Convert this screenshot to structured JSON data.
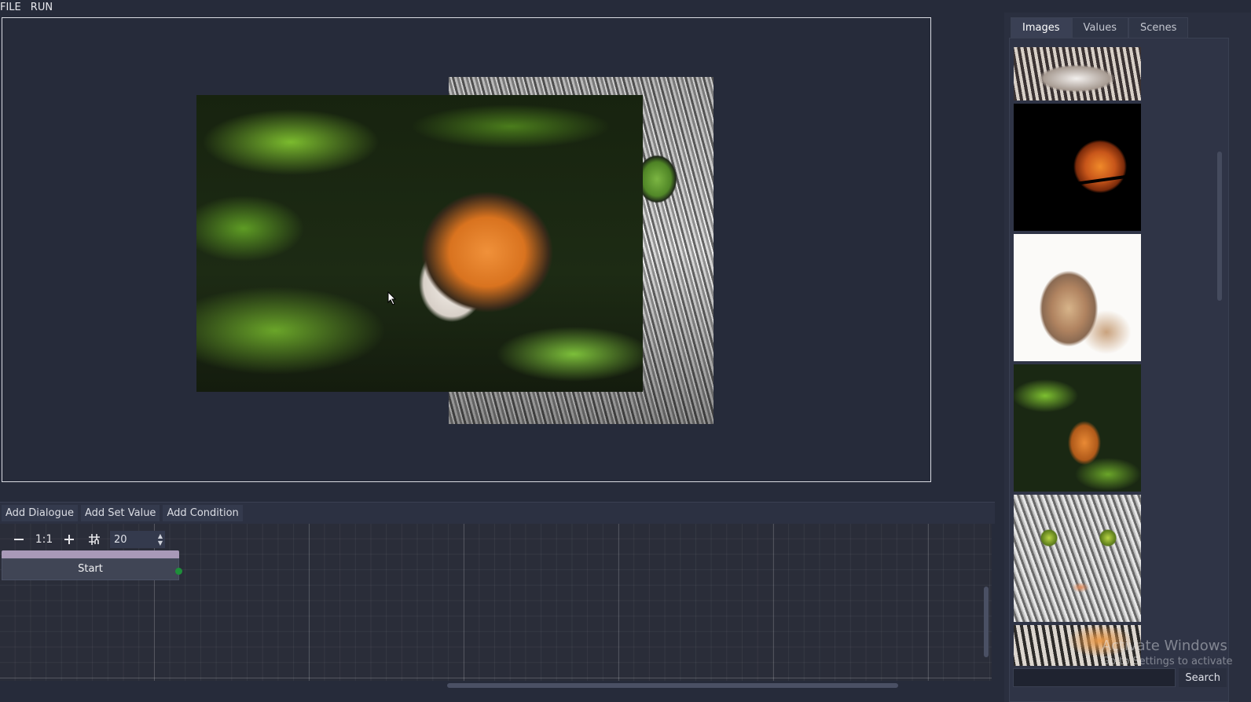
{
  "menu": {
    "file": "FILE",
    "run": "RUN"
  },
  "canvas": {
    "images": [
      {
        "name": "cat-closeup"
      },
      {
        "name": "tiger-in-water"
      }
    ]
  },
  "side_panel": {
    "tabs": [
      {
        "label": "Images",
        "active": true
      },
      {
        "label": "Values",
        "active": false
      },
      {
        "label": "Scenes",
        "active": false
      }
    ],
    "search": {
      "value": "",
      "button_label": "Search"
    }
  },
  "graph_toolbar": {
    "add_dialogue": "Add Dialogue",
    "add_set_value": "Add Set Value",
    "add_condition": "Add Condition"
  },
  "graph": {
    "zoom_reset_label": "1:1",
    "snap_value": "20",
    "start_node_label": "Start"
  },
  "watermark": {
    "title": "Activate Windows",
    "subtitle": "Go to Settings to activate"
  },
  "colors": {
    "background": "#262b3a",
    "node_header": "#a899b8",
    "node_port": "#1e8f3a"
  }
}
